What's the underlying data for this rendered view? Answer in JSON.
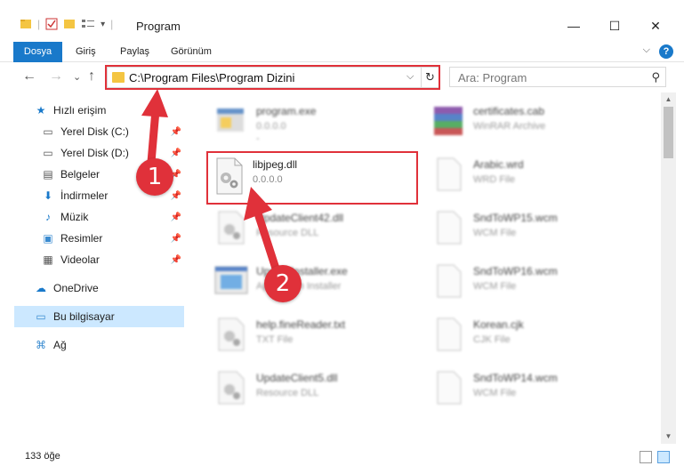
{
  "window": {
    "title": "Program",
    "minimize": "—",
    "maximize": "☐",
    "close": "✕"
  },
  "ribbon": {
    "tabs": [
      "Dosya",
      "Giriş",
      "Paylaş",
      "Görünüm"
    ],
    "help": "?",
    "collapse": "⌵"
  },
  "nav": {
    "back": "←",
    "forward": "→",
    "recent": "⌄",
    "up": "↑",
    "address": "C:\\Program Files\\Program Dizini",
    "address_dropdown": "⌵",
    "refresh": "↻",
    "search_placeholder": "Ara: Program",
    "search_icon": "⚲"
  },
  "sidebar": {
    "items": [
      {
        "label": "Hızlı erişim",
        "icon": "star-icon",
        "glyph": "★",
        "pinned": false,
        "selected": false
      },
      {
        "label": "Yerel Disk (C:)",
        "icon": "drive-icon",
        "glyph": "▭",
        "pinned": true,
        "selected": false
      },
      {
        "label": "Yerel Disk (D:)",
        "icon": "drive-icon",
        "glyph": "▭",
        "pinned": true,
        "selected": false
      },
      {
        "label": "Belgeler",
        "icon": "documents-icon",
        "glyph": "▤",
        "pinned": true,
        "selected": false
      },
      {
        "label": "İndirmeler",
        "icon": "download-icon",
        "glyph": "⬇",
        "pinned": true,
        "selected": false
      },
      {
        "label": "Müzik",
        "icon": "music-icon",
        "glyph": "♪",
        "pinned": true,
        "selected": false
      },
      {
        "label": "Resimler",
        "icon": "pictures-icon",
        "glyph": "▣",
        "pinned": true,
        "selected": false
      },
      {
        "label": "Videolar",
        "icon": "video-icon",
        "glyph": "▦",
        "pinned": true,
        "selected": false
      },
      {
        "label": "OneDrive",
        "icon": "cloud-icon",
        "glyph": "☁",
        "pinned": false,
        "selected": false
      },
      {
        "label": "Bu bilgisayar",
        "icon": "computer-icon",
        "glyph": "▭",
        "pinned": false,
        "selected": true
      },
      {
        "label": "Ağ",
        "icon": "network-icon",
        "glyph": "⌘",
        "pinned": false,
        "selected": false
      }
    ]
  },
  "files": [
    {
      "name": "program.exe",
      "sub": "0.0.0.0",
      "sub2": "-",
      "icon": "exe-icon",
      "blurred": true
    },
    {
      "name": "certificates.cab",
      "sub": "WinRAR Archive",
      "sub2": "",
      "icon": "archive-icon",
      "blurred": true
    },
    {
      "name": "libjpeg.dll",
      "sub": "0.0.0.0",
      "sub2": "-",
      "icon": "dll-gear-icon",
      "blurred": false
    },
    {
      "name": "Arabic.wrd",
      "sub": "WRD File",
      "sub2": "",
      "icon": "blank-file-icon",
      "blurred": true
    },
    {
      "name": "UpdateClient42.dll",
      "sub": "Resource DLL",
      "sub2": "",
      "icon": "dll-gear-icon",
      "blurred": true
    },
    {
      "name": "SndToWP15.wcm",
      "sub": "WCM File",
      "sub2": "",
      "icon": "blank-file-icon",
      "blurred": true
    },
    {
      "name": "UpdateInstaller.exe",
      "sub": "Application Installer",
      "sub2": "",
      "icon": "installer-icon",
      "blurred": true
    },
    {
      "name": "SndToWP16.wcm",
      "sub": "WCM File",
      "sub2": "",
      "icon": "blank-file-icon",
      "blurred": true
    },
    {
      "name": "help.fineReader.txt",
      "sub": "TXT File",
      "sub2": "",
      "icon": "dll-gear-icon",
      "blurred": true
    },
    {
      "name": "Korean.cjk",
      "sub": "CJK File",
      "sub2": "",
      "icon": "blank-file-icon",
      "blurred": true
    },
    {
      "name": "UpdateClient5.dll",
      "sub": "Resource DLL",
      "sub2": "",
      "icon": "dll-gear-icon",
      "blurred": true
    },
    {
      "name": "SndToWP14.wcm",
      "sub": "WCM File",
      "sub2": "",
      "icon": "blank-file-icon",
      "blurred": true
    }
  ],
  "status": {
    "count": "133 öğe"
  },
  "annotations": {
    "step1": "1",
    "step2": "2",
    "color": "#e0313a"
  }
}
